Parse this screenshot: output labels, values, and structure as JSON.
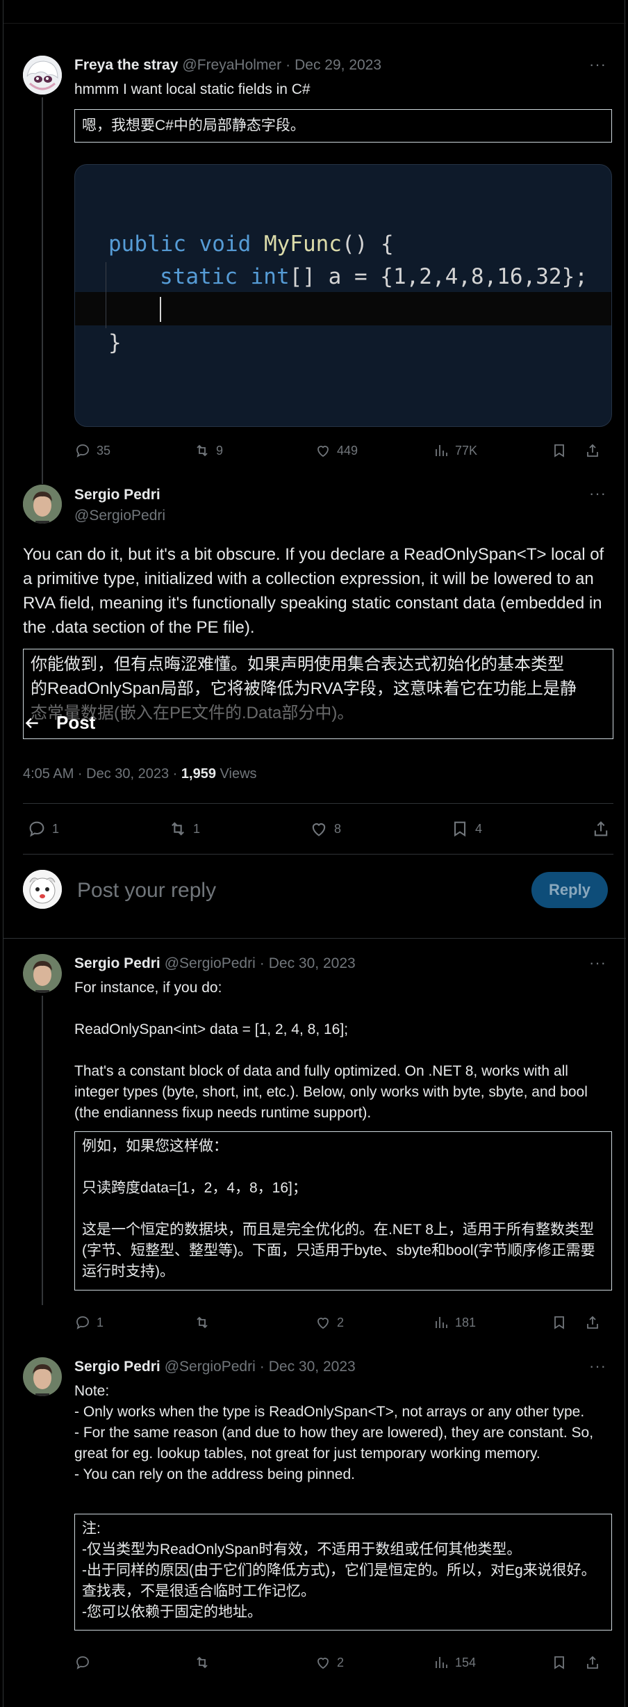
{
  "tweet1": {
    "name": "Freya the stray",
    "handle": "@FreyaHolmer",
    "date": "Dec 29, 2023",
    "text": "hmmm I want local static fields in C#",
    "translation": "嗯，我想要C#中的局部静态字段。",
    "code": {
      "line1_kw": "public void ",
      "line1_fn": "MyFunc",
      "line1_rest": "() {",
      "line2_kw": "static int",
      "line2_rest": "[] a = {1,2,4,8,16,32};",
      "line4": "}"
    },
    "stats": {
      "replies": "35",
      "reposts": "9",
      "likes": "449",
      "views": "77K"
    }
  },
  "main": {
    "name": "Sergio Pedri",
    "handle": "@SergioPedri",
    "text": "You can do it, but it's a bit obscure. If you declare a ReadOnlySpan<T> local of a primitive type, initialized with a collection expression, it will be lowered to an RVA field, meaning it's functionally speaking static constant data (embedded in the .data section of the PE file).",
    "translation_line1": "你能做到，但有点晦涩难懂。如果声明使用集合表达式初始化的基本类型",
    "translation_line2": "的ReadOnlySpan局部，它将被降低为RVA字段，这意味着它在功能上是静",
    "translation_line3": "态常量数据(嵌入在PE文件的.Data部分中)。",
    "header_title": "Post",
    "time": "4:05 AM · Dec 30, 2023 · ",
    "views_count": "1,959",
    "views_label": " Views",
    "stats": {
      "replies": "1",
      "reposts": "1",
      "likes": "8",
      "bookmarks": "4"
    }
  },
  "reply_box": {
    "placeholder": "Post your reply",
    "button": "Reply"
  },
  "reply1": {
    "name": "Sergio Pedri",
    "handle": "@SergioPedri",
    "date": "Dec 30, 2023",
    "line1": "For instance, if you do:",
    "line2": "ReadOnlySpan<int> data = [1, 2, 4, 8, 16];",
    "line3": "That's a constant block of data and fully optimized. On .NET 8, works with all integer types (byte, short, int, etc.). Below, only works with byte, sbyte, and bool (the endianness fixup needs runtime support).",
    "tr1": "例如，如果您这样做：",
    "tr2": "只读跨度data=[1，2，4，8，16]；",
    "tr3": "这是一个恒定的数据块，而且是完全优化的。在.NET 8上，适用于所有整数类型(字节、短整型、整型等)。下面，只适用于byte、sbyte和bool(字节顺序修正需要运行时支持)。",
    "stats": {
      "replies": "1",
      "likes": "2",
      "views": "181"
    }
  },
  "reply2": {
    "name": "Sergio Pedri",
    "handle": "@SergioPedri",
    "date": "Dec 30, 2023",
    "l1": "Note:",
    "l2": "- Only works when the type is ReadOnlySpan<T>, not arrays or any other type.",
    "l3": "- For the same reason (and due to how they are lowered), they are constant. So, great for eg. lookup tables, not great for just temporary working memory.",
    "l4": "- You can rely on the address being pinned.",
    "t1": "注:",
    "t2": "-仅当类型为ReadOnlySpan时有效，不适用于数组或任何其他类型。",
    "t3": "-出于同样的原因(由于它们的降低方式)，它们是恒定的。所以，对Eg来说很好。查找表，不是很适合临时工作记忆。",
    "t4": "-您可以依赖于固定的地址。",
    "stats": {
      "likes": "2",
      "views": "154"
    }
  },
  "icons": [
    "reply-icon",
    "repost-icon",
    "like-icon",
    "views-icon",
    "bookmark-icon",
    "share-icon",
    "back-arrow-icon",
    "more-icon"
  ]
}
